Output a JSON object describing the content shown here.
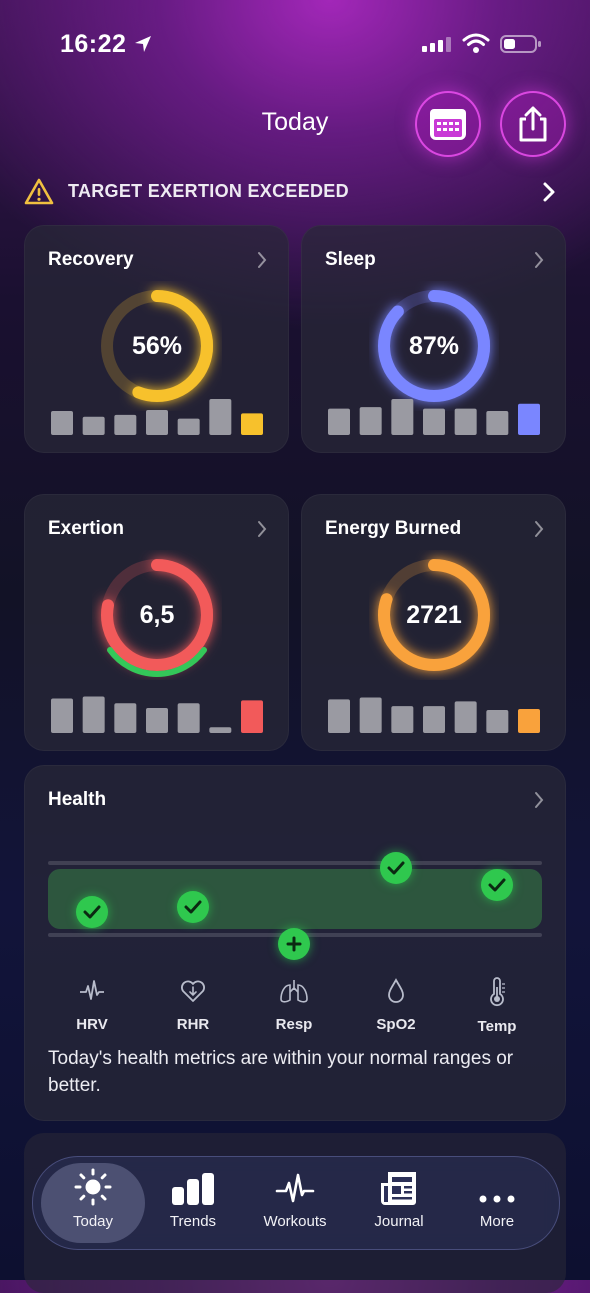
{
  "status_bar": {
    "time": "16:22"
  },
  "header": {
    "title": "Today"
  },
  "alert": {
    "text": "TARGET EXERTION EXCEEDED"
  },
  "cards": {
    "recovery": {
      "title": "Recovery",
      "value": "56%",
      "progress": 0.56,
      "color": "#f7c12c",
      "bars": [
        0.5,
        0.38,
        0.42,
        0.52,
        0.34,
        0.75,
        0.45
      ]
    },
    "sleep": {
      "title": "Sleep",
      "value": "87%",
      "progress": 0.87,
      "color": "#7a86ff",
      "bars": [
        0.55,
        0.58,
        0.75,
        0.55,
        0.55,
        0.5,
        0.65
      ]
    },
    "exertion": {
      "title": "Exertion",
      "value": "6,5",
      "progress": 0.78,
      "color": "#f25a5a",
      "bars": [
        0.72,
        0.76,
        0.62,
        0.52,
        0.62,
        0.12,
        0.68
      ]
    },
    "energy": {
      "title": "Energy Burned",
      "value": "2721",
      "progress": 0.8,
      "color": "#f9a23c",
      "bars": [
        0.7,
        0.74,
        0.56,
        0.56,
        0.66,
        0.48,
        0.5
      ]
    }
  },
  "health": {
    "title": "Health",
    "metrics": [
      {
        "label": "HRV",
        "icon": "heartbeat-wave-icon"
      },
      {
        "label": "RHR",
        "icon": "heart-down-icon"
      },
      {
        "label": "Resp",
        "icon": "lungs-icon"
      },
      {
        "label": "SpO2",
        "icon": "droplet-icon"
      },
      {
        "label": "Temp",
        "icon": "thermometer-icon"
      }
    ],
    "summary": "Today's health metrics are within your normal ranges or better."
  },
  "tabbar": {
    "tabs": [
      {
        "label": "Today",
        "icon": "sun-icon",
        "active": true
      },
      {
        "label": "Trends",
        "icon": "bar-chart-icon",
        "active": false
      },
      {
        "label": "Workouts",
        "icon": "pulse-icon",
        "active": false
      },
      {
        "label": "Journal",
        "icon": "newspaper-icon",
        "active": false
      },
      {
        "label": "More",
        "icon": "ellipsis-icon",
        "active": false
      }
    ]
  },
  "colors": {
    "accent_purple": "#c93ad6",
    "ok_green": "#2fc84e"
  }
}
